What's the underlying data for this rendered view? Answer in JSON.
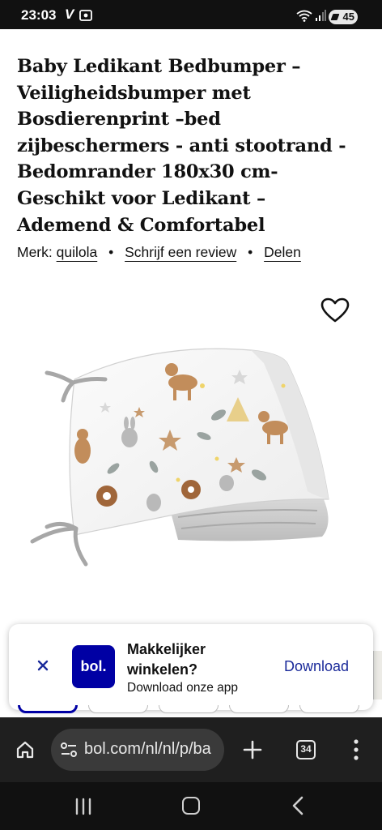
{
  "status_bar": {
    "time": "23:03",
    "carrier_icon": "V",
    "battery": "45"
  },
  "product": {
    "title": "Baby Ledikant Bedbumper – Veiligheidsbumper met Bosdierenprint –bed zijbeschermers - anti stootrand - Bedomrander 180x30 cm- Geschikt voor Ledikant – Ademend & Comfortabel",
    "brand_label": "Merk:",
    "brand": "quilola",
    "review_link": "Schrijf een review",
    "share_link": "Delen",
    "separator": "•",
    "wishlist_icon": "heart-icon",
    "image_alt": "bed bumper with woodland animal print"
  },
  "app_banner": {
    "logo": "bol.",
    "title": "Makkelijker winkelen?",
    "subtitle": "Download onze app",
    "download_label": "Download",
    "close_icon": "close-icon"
  },
  "browser": {
    "url": "bol.com/nl/nl/p/ba",
    "tab_count": "34"
  },
  "colors": {
    "brand_blue": "#0000a4",
    "download_blue": "#1a2a9a",
    "browser_bg": "#1f1f1f"
  }
}
